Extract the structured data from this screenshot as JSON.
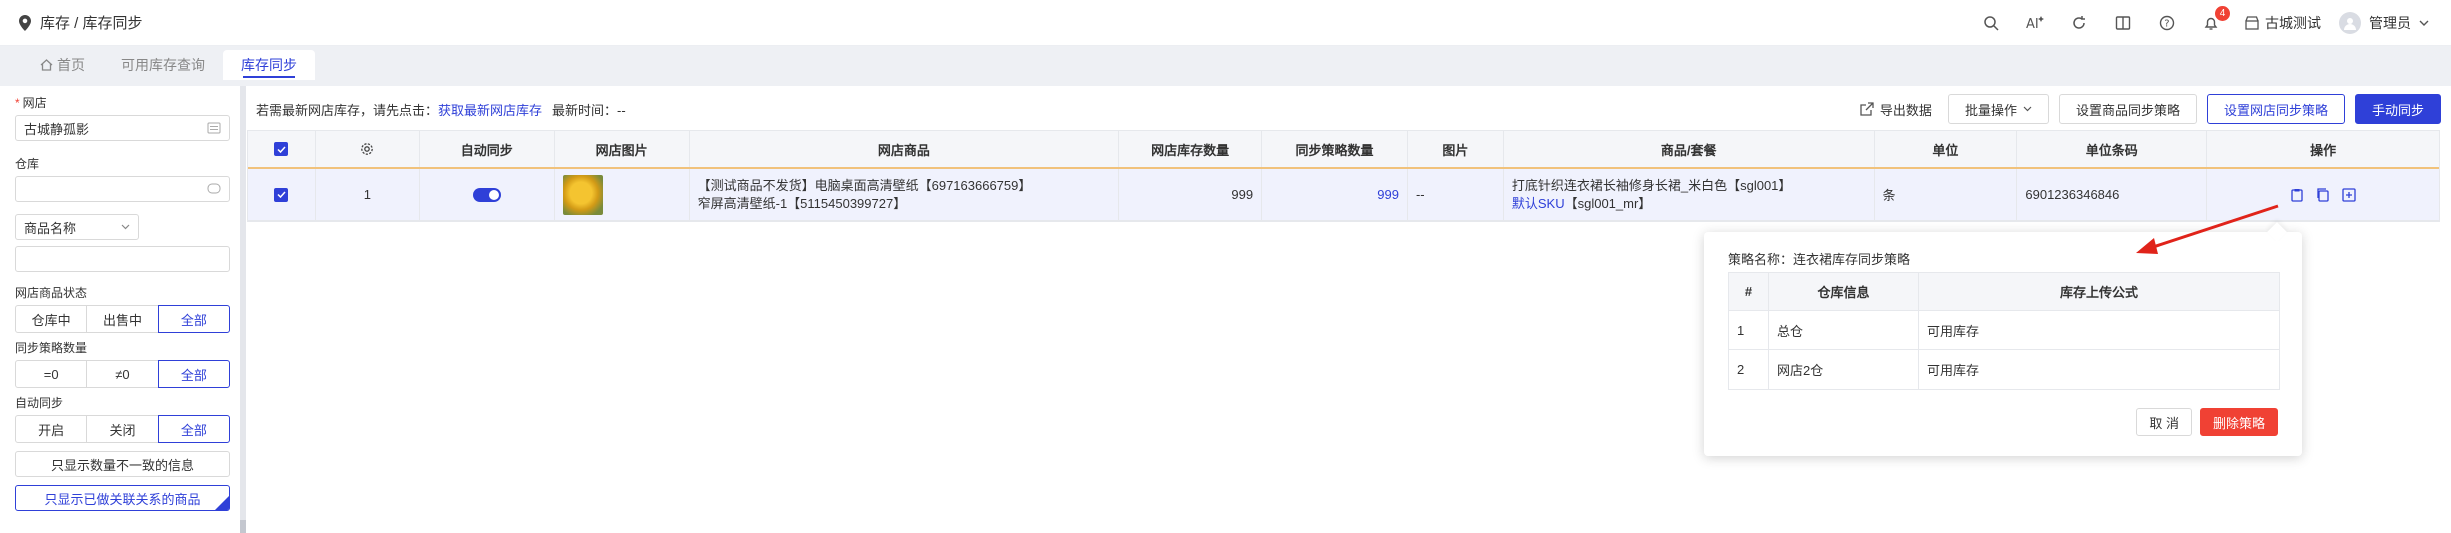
{
  "breadcrumb": "库存 / 库存同步",
  "header": {
    "notification_count": "4",
    "store_name": "古城测试",
    "user_name": "管理员"
  },
  "tabs": [
    {
      "label": "首页"
    },
    {
      "label": "可用库存查询"
    },
    {
      "label": "库存同步"
    }
  ],
  "sidebar": {
    "shop_label": "网店",
    "shop_value": "古城静孤影",
    "warehouse_label": "仓库",
    "warehouse_value": "",
    "search_field_select": "商品名称",
    "search_value": "",
    "status_label": "网店商品状态",
    "status_options": [
      "仓库中",
      "出售中",
      "全部"
    ],
    "strategy_label": "同步策略数量",
    "strategy_options": [
      "=0",
      "≠0",
      "全部"
    ],
    "autosync_label": "自动同步",
    "autosync_options": [
      "开启",
      "关闭",
      "全部"
    ],
    "mismatch_btn": "只显示数量不一致的信息",
    "linked_btn": "只显示已做关联关系的商品"
  },
  "main": {
    "notice": "若需最新网店库存，请先点击：",
    "notice_link": "获取最新网店库存",
    "notice_time": "最新时间：--",
    "export_btn": "导出数据",
    "batch_btn": "批量操作",
    "set_product_btn": "设置商品同步策略",
    "set_shop_btn": "设置网店同步策略",
    "manual_btn": "手动同步"
  },
  "table": {
    "headers": [
      "",
      "",
      "自动同步",
      "网店图片",
      "网店商品",
      "网店库存数量",
      "同步策略数量",
      "图片",
      "商品/套餐",
      "单位",
      "单位条码",
      "操作"
    ],
    "rows": [
      {
        "index": "1",
        "product_line1": "【测试商品不发货】电脑桌面高清壁纸【697163666759】",
        "product_line2": "窄屏高清壁纸-1【5115450399727】",
        "shop_stock": "999",
        "strategy_qty": "999",
        "image": "--",
        "goods_line1": "打底针织连衣裙长袖修身长裙_米白色【sgl001】",
        "goods_line2_link": "默认SKU",
        "goods_line2_rest": "【sgl001_mr】",
        "unit": "条",
        "barcode": "6901236346846"
      }
    ]
  },
  "popover": {
    "title": "策略名称：连衣裙库存同步策略",
    "headers": [
      "#",
      "仓库信息",
      "库存上传公式"
    ],
    "rows": [
      {
        "no": "1",
        "warehouse": "总仓",
        "formula": "可用库存"
      },
      {
        "no": "2",
        "warehouse": "网店2仓",
        "formula": "可用库存"
      }
    ],
    "cancel_btn": "取 消",
    "delete_btn": "删除策略"
  },
  "colors": {
    "primary": "#2f40d8",
    "danger": "#f04134",
    "header_accent": "#f1c27b"
  }
}
